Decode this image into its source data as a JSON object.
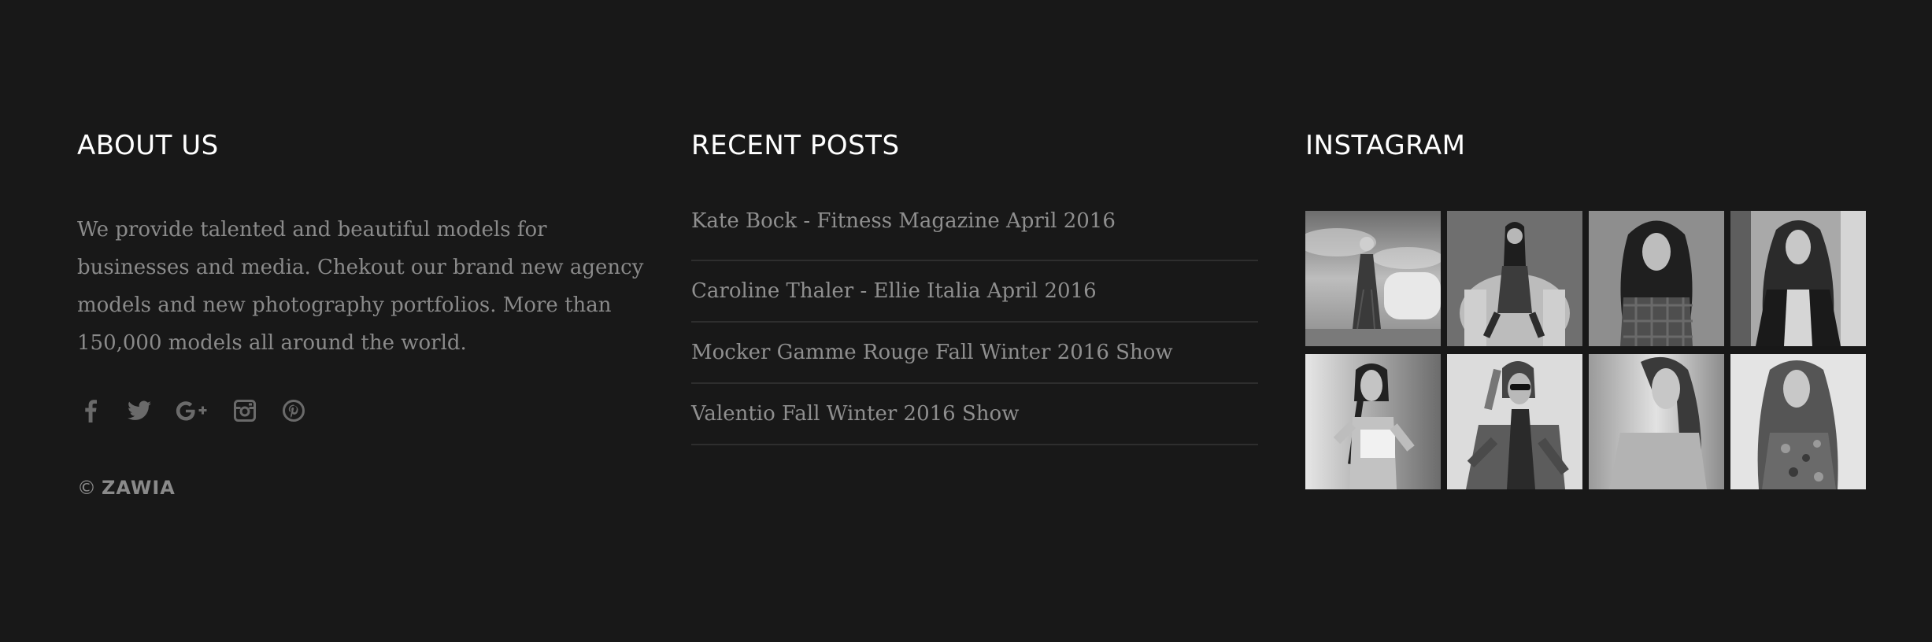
{
  "about": {
    "heading": "ABOUT US",
    "text": "We provide talented and beautiful models for businesses and media. Chekout our brand new agency models and new photography portfolios. More than 150,000 models all around the world.",
    "social": [
      "facebook-icon",
      "twitter-icon",
      "google-plus-icon",
      "instagram-icon",
      "pinterest-icon"
    ],
    "copyright_symbol": "©",
    "copyright_name": "ZAWIA"
  },
  "posts": {
    "heading": "RECENT POSTS",
    "items": [
      "Kate Bock - Fitness Magazine April 2016",
      "Caroline Thaler - Ellie Italia April 2016",
      "Mocker Gamme Rouge Fall Winter 2016 Show",
      "Valentio Fall Winter 2016 Show"
    ]
  },
  "instagram": {
    "heading": "INSTAGRAM",
    "thumbnails": [
      "photo-thumbnail-1",
      "photo-thumbnail-2",
      "photo-thumbnail-3",
      "photo-thumbnail-4",
      "photo-thumbnail-5",
      "photo-thumbnail-6",
      "photo-thumbnail-7",
      "photo-thumbnail-8"
    ]
  },
  "colors": {
    "background": "#181818",
    "heading": "#ffffff",
    "text": "#8a8a8a",
    "divider": "#2e2e2e"
  }
}
